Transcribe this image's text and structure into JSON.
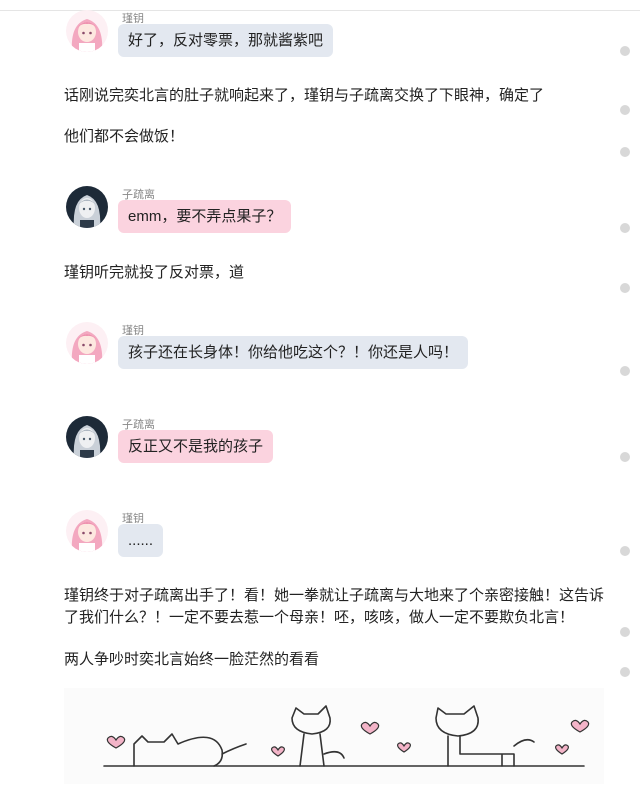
{
  "messages": [
    {
      "speaker": "瑾钥",
      "avatar": "pink-hair-girl-avatar",
      "text": "好了，反对零票，那就酱紫吧",
      "bubble": "blue"
    },
    {
      "speaker": "子疏离",
      "avatar": "silver-hair-boy-avatar",
      "text": "emm，要不弄点果子？",
      "bubble": "pink"
    },
    {
      "speaker": "瑾钥",
      "avatar": "pink-hair-girl-avatar",
      "text": "孩子还在长身体！你给他吃这个？！你还是人吗！",
      "bubble": "blue"
    },
    {
      "speaker": "子疏离",
      "avatar": "silver-hair-boy-avatar",
      "text": "反正又不是我的孩子",
      "bubble": "pink"
    },
    {
      "speaker": "瑾钥",
      "avatar": "pink-hair-girl-avatar",
      "text": "......",
      "bubble": "blue"
    }
  ],
  "paragraphs": [
    "话刚说完奕北言的肚子就响起来了，瑾钥与子疏离交换了下眼神，确定了",
    "他们都不会做饭！",
    "瑾钥听完就投了反对票，道",
    "瑾钥终于对子疏离出手了！看！她一拳就让子疏离与大地来了个亲密接触！这告诉了我们什么？！一定不要去惹一个母亲！呸，咳咳，做人一定不要欺负北言！",
    "两人争吵时奕北言始终一脸茫然的看看"
  ],
  "illustration": "doodle-cats-and-hearts",
  "colors": {
    "bubble_blue": "#e3e8f0",
    "bubble_pink": "#fbd3df",
    "scroll_dot": "#d8d8d8"
  }
}
